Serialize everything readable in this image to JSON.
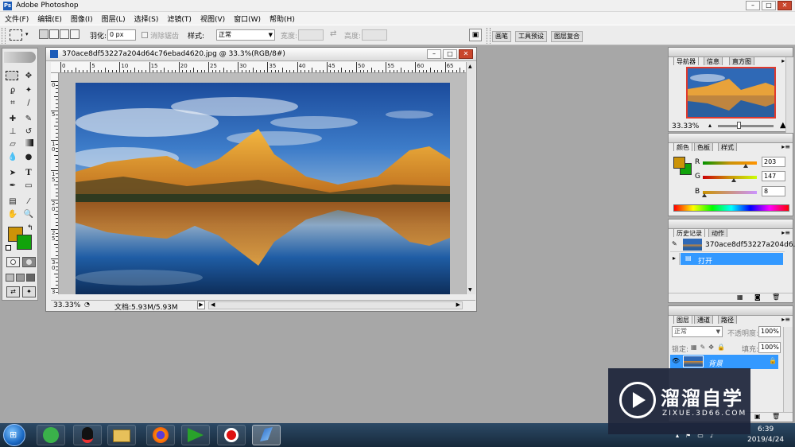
{
  "app": {
    "title": "Adobe Photoshop",
    "logo": "Ps"
  },
  "window_buttons": [
    "–",
    "□",
    "✕"
  ],
  "menu": [
    "文件(F)",
    "编辑(E)",
    "图像(I)",
    "图层(L)",
    "选择(S)",
    "滤镜(T)",
    "视图(V)",
    "窗口(W)",
    "帮助(H)"
  ],
  "options": {
    "feather_label": "羽化:",
    "feather_value": "0 px",
    "antialias_label": "消除锯齿",
    "style_label": "样式:",
    "style_value": "正常",
    "width_label": "宽度:",
    "height_label": "高度:"
  },
  "palette_well": [
    "画笔",
    "工具预设",
    "图层复合"
  ],
  "document": {
    "title": "370ace8df53227a204d64c76ebad4620.jpg @ 33.3%(RGB/8#)",
    "zoom": "33.33%",
    "doc_size": "文档:5.93M/5.93M",
    "ruler_h": [
      "0",
      "5",
      "10",
      "15",
      "20",
      "25",
      "30",
      "35",
      "40",
      "45",
      "50",
      "55",
      "60",
      "65"
    ],
    "ruler_v": [
      "0",
      "5",
      "1\n0",
      "1\n5",
      "2\n0",
      "2\n5",
      "3\n0",
      "3\n5"
    ]
  },
  "navigator": {
    "tabs": [
      "导航器",
      "信息",
      "直方图"
    ],
    "zoom": "33.33%"
  },
  "color_panel": {
    "tabs": [
      "颜色",
      "色板",
      "样式"
    ],
    "r_label": "R",
    "g_label": "G",
    "b_label": "B",
    "r_value": "203",
    "g_value": "147",
    "b_value": "8",
    "r_fraction": 0.796,
    "g_fraction": 0.576,
    "b_fraction": 0.031,
    "foreground": "#cb9308",
    "background": "#11a30b"
  },
  "history": {
    "tabs": [
      "历史记录",
      "动作"
    ],
    "snapshot": "370ace8df53227a204d6...",
    "step": "打开"
  },
  "layers": {
    "tabs": [
      "图层",
      "通道",
      "路径"
    ],
    "blend_mode": "正常",
    "opacity_label": "不透明度:",
    "opacity": "100%",
    "lock_label": "锁定:",
    "fill_label": "填充:",
    "fill": "100%",
    "layer_name": "背景"
  },
  "taskbar": {
    "time": "6:39",
    "date": "2019/4/24"
  },
  "watermark": {
    "brand": "溜溜自学",
    "url": "ZIXUE.3D66.COM"
  },
  "colors": {
    "selection_blue": "#3399ff",
    "taskbar": "#1f3447"
  }
}
